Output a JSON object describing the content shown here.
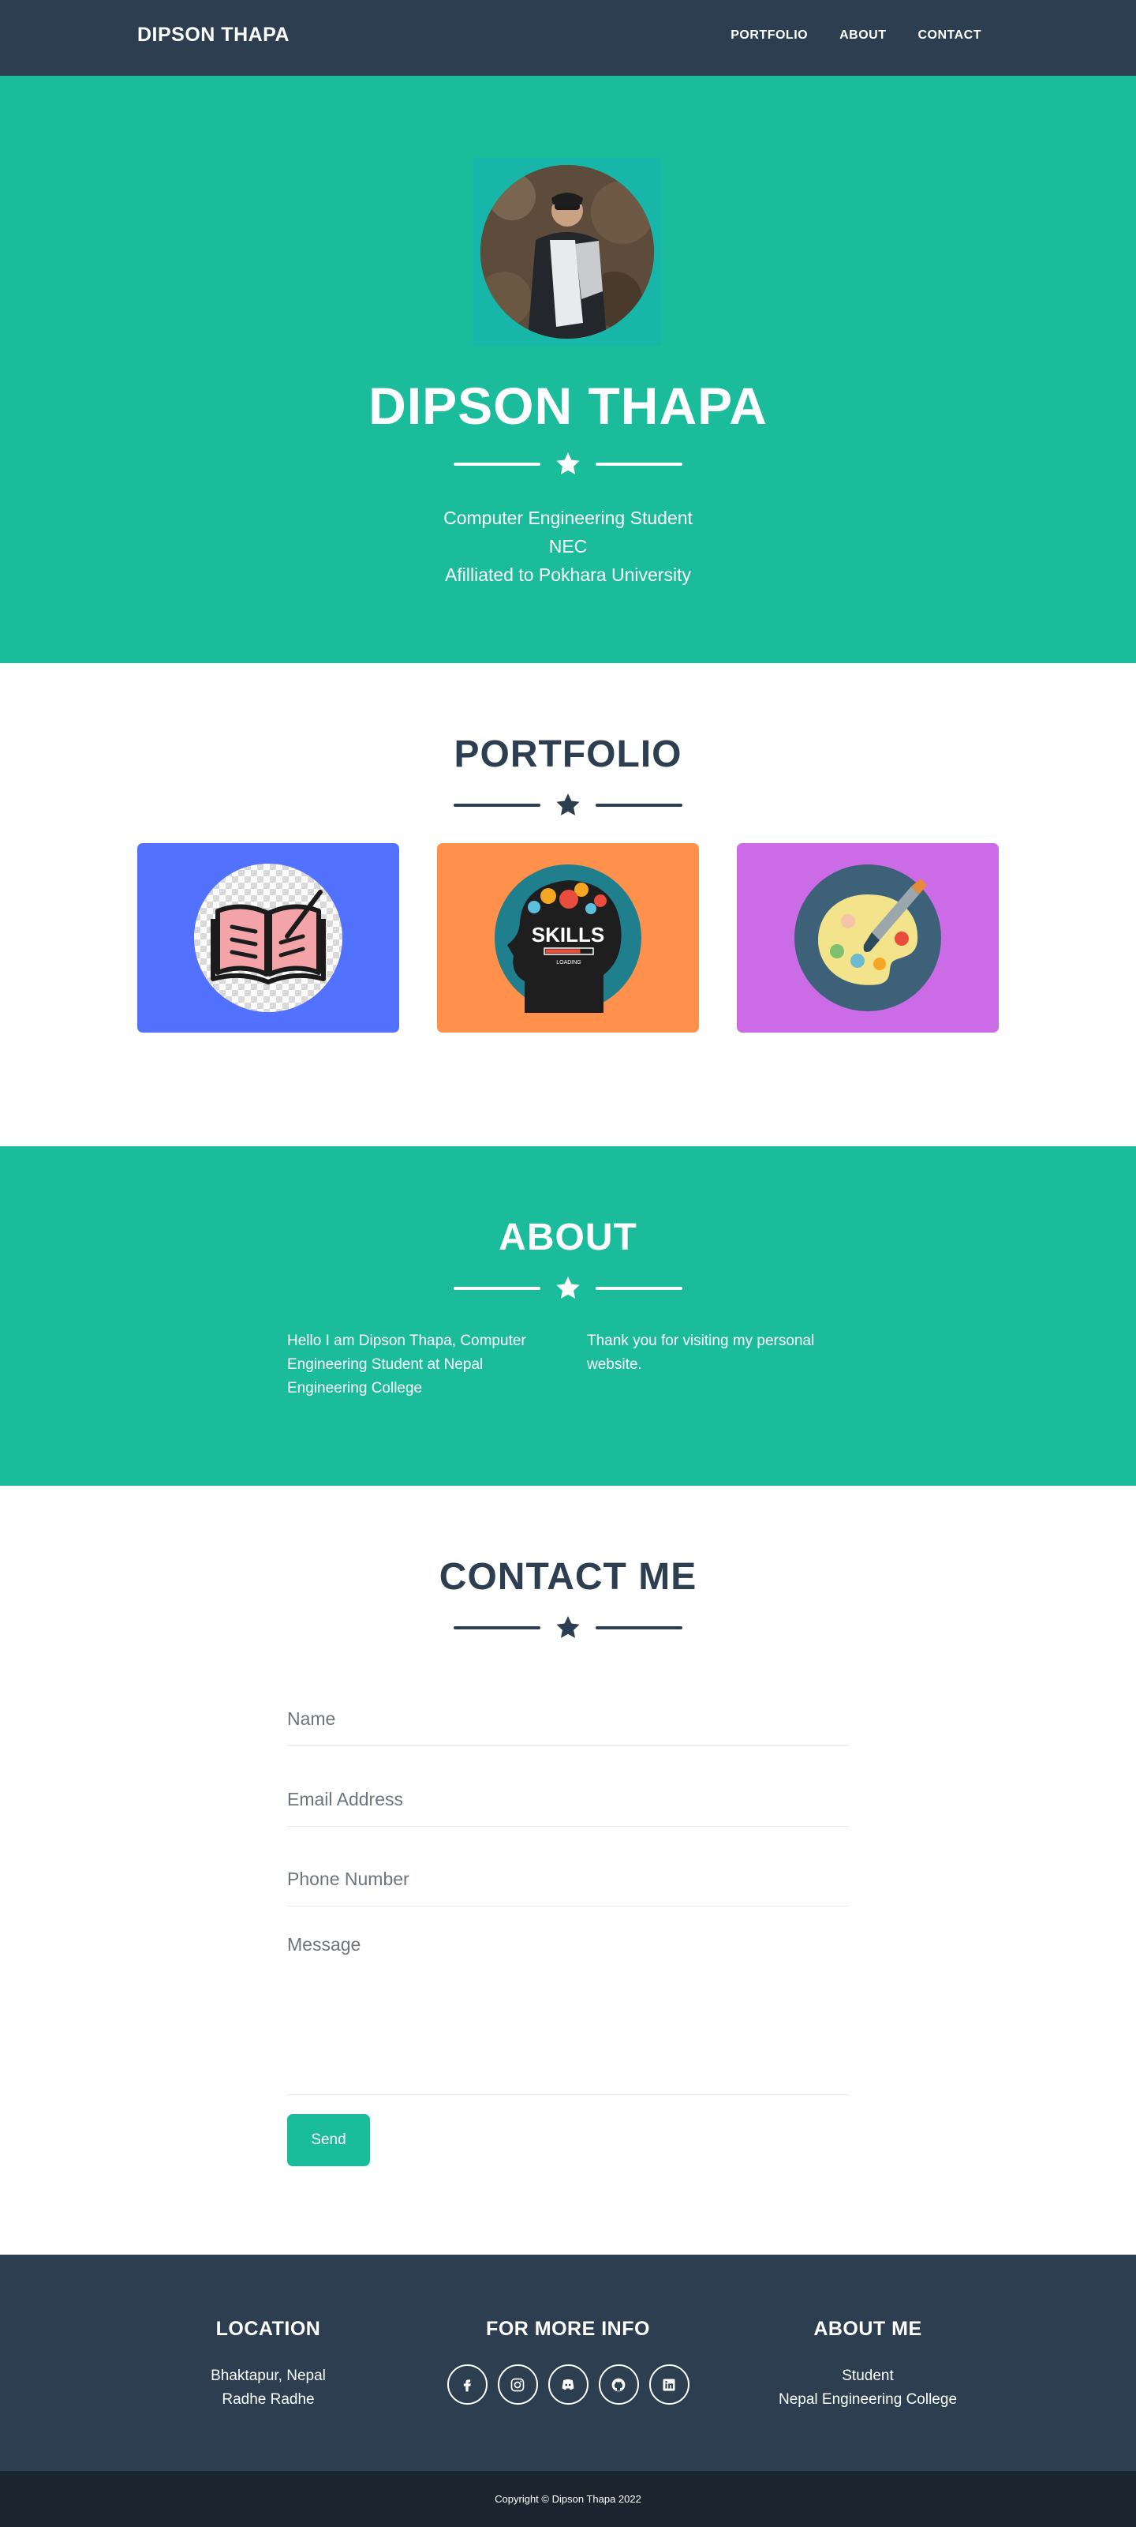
{
  "nav": {
    "brand": "DIPSON THAPA",
    "links": [
      "PORTFOLIO",
      "ABOUT",
      "CONTACT"
    ]
  },
  "hero": {
    "name": "DIPSON THAPA",
    "lines": [
      "Computer Engineering Student",
      "NEC",
      "Afilliated to Pokhara University"
    ]
  },
  "portfolio": {
    "title": "PORTFOLIO",
    "cards": [
      {
        "icon": "open-book-icon",
        "color": "#5271ff"
      },
      {
        "icon": "skills-head-icon",
        "label": "SKILLS",
        "sublabel": "LOADING",
        "color": "#ff914d"
      },
      {
        "icon": "paint-palette-icon",
        "color": "#cb6ce6"
      }
    ]
  },
  "about": {
    "title": "ABOUT",
    "left": "Hello I am Dipson Thapa, Computer Engineering Student at Nepal Engineering College",
    "right": "Thank you for visiting my personal website."
  },
  "contact": {
    "title": "CONTACT ME",
    "name_placeholder": "Name",
    "email_placeholder": "Email Address",
    "phone_placeholder": "Phone Number",
    "message_placeholder": "Message",
    "send_label": "Send"
  },
  "footer": {
    "location": {
      "heading": "LOCATION",
      "lines": [
        "Bhaktapur, Nepal",
        "Radhe Radhe"
      ]
    },
    "more_info": {
      "heading": "FOR MORE INFO",
      "socials": [
        "facebook-icon",
        "instagram-icon",
        "discord-icon",
        "github-icon",
        "linkedin-icon"
      ]
    },
    "about_me": {
      "heading": "ABOUT ME",
      "lines": [
        "Student",
        "Nepal Engineering College"
      ]
    }
  },
  "copyright": "Copyright © Dipson Thapa 2022",
  "colors": {
    "primary": "#1abc9c",
    "dark": "#2c3e50",
    "darker": "#1a252f"
  }
}
